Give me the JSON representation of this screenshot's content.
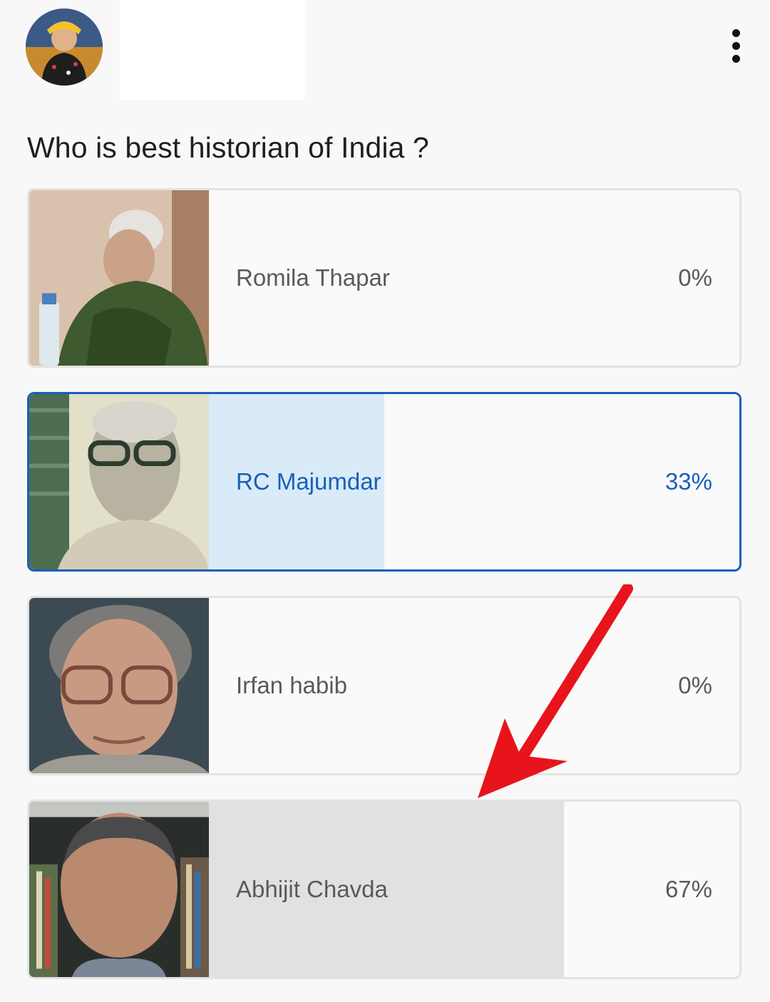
{
  "header": {
    "avatar_icon": "user-avatar",
    "menu_icon": "more-vertical-icon"
  },
  "poll": {
    "question": "Who is best historian of India ?",
    "colors": {
      "selected_border": "#1a5fba",
      "selected_fill": "#d9ebf7",
      "result_fill": "#e1e1e1",
      "annotation_arrow": "#e8141c"
    },
    "options": [
      {
        "label": "Romila Thapar",
        "percent_text": "0%",
        "share": 0.0,
        "selected": false
      },
      {
        "label": "RC Majumdar",
        "percent_text": "33%",
        "share": 0.33,
        "selected": true
      },
      {
        "label": "Irfan habib",
        "percent_text": "0%",
        "share": 0.0,
        "selected": false
      },
      {
        "label": "Abhijit Chavda",
        "percent_text": "67%",
        "share": 0.67,
        "selected": false
      }
    ]
  },
  "annotation": {
    "icon": "red-arrow-icon"
  }
}
